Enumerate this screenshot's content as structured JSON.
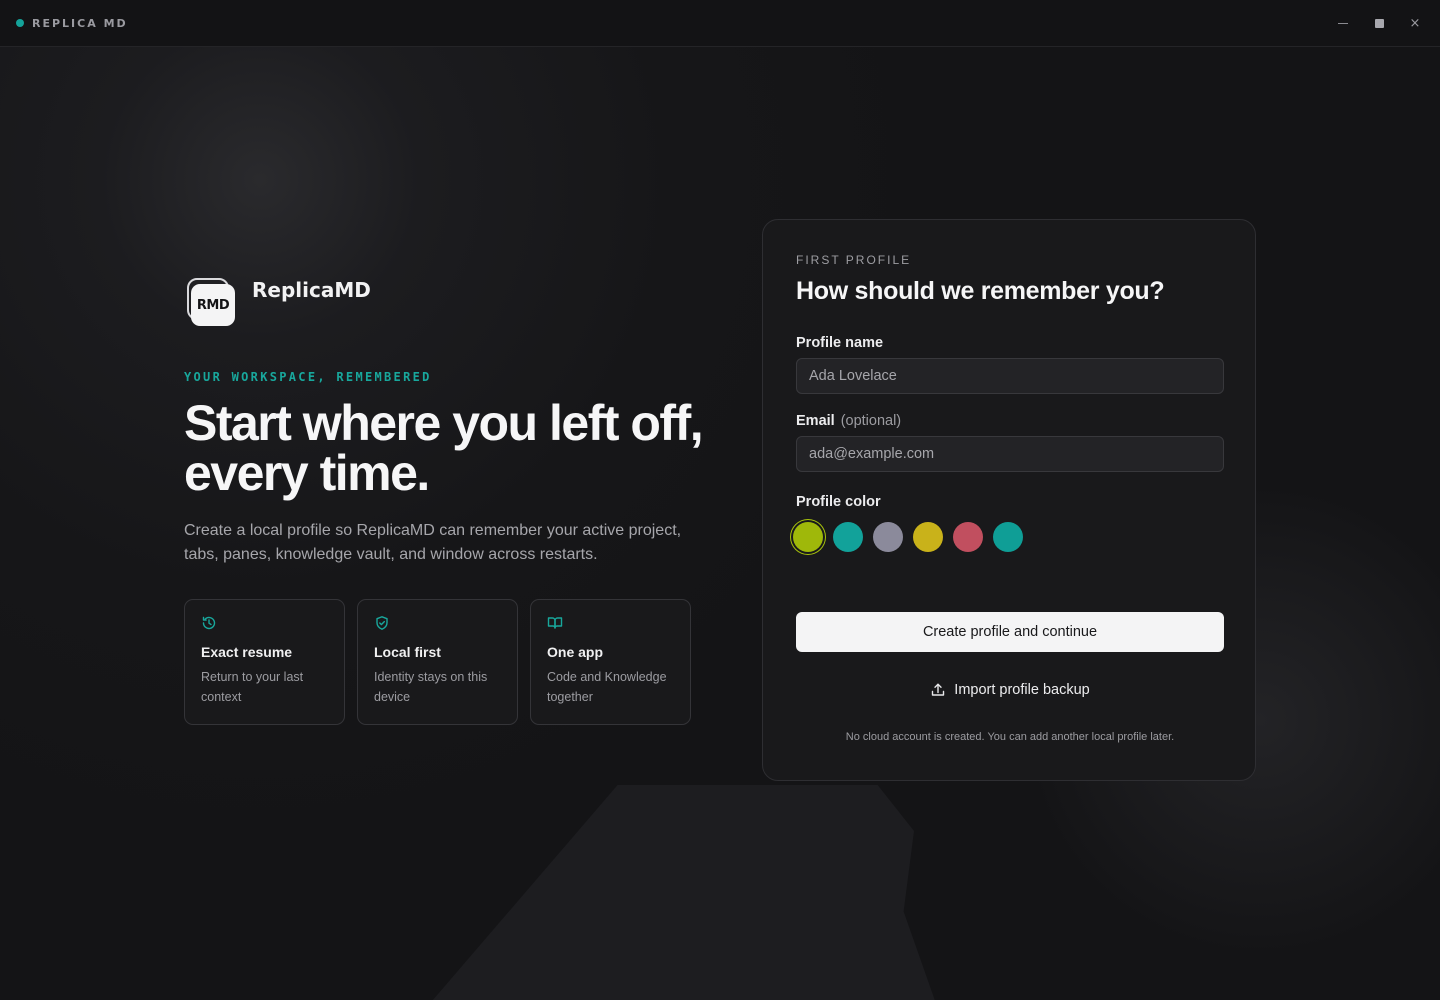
{
  "window": {
    "title": "REPLICA MD",
    "accent": "#14a39a",
    "controls": {
      "minimize": "minimize-icon",
      "maximize": "maximize-icon",
      "close": "×"
    }
  },
  "brand": {
    "logo_text": "RMD",
    "name": "ReplicaMD"
  },
  "hero": {
    "eyebrow": "YOUR WORKSPACE, REMEMBERED",
    "headline": "Start where you left off, every time.",
    "lead": "Create a local profile so ReplicaMD can remember your active project, tabs, panes, knowledge vault, and window across restarts."
  },
  "features": [
    {
      "icon": "history-icon",
      "title": "Exact resume",
      "desc": "Return to your last context"
    },
    {
      "icon": "shield-check-icon",
      "title": "Local first",
      "desc": "Identity stays on this device"
    },
    {
      "icon": "book-open-icon",
      "title": "One app",
      "desc": "Code and Knowledge together"
    }
  ],
  "form": {
    "eyebrow": "FIRST PROFILE",
    "title": "How should we remember you?",
    "name_label": "Profile name",
    "name_placeholder": "Ada Lovelace",
    "email_label": "Email",
    "email_optional": "(optional)",
    "email_placeholder": "ada@example.com",
    "color_label": "Profile color",
    "colors": [
      "#9fb80a",
      "#12a29a",
      "#8b8a9b",
      "#c9b21a",
      "#c14f5f",
      "#0f9e96"
    ],
    "selected_color_index": 0,
    "submit_label": "Create profile and continue",
    "import_label": "Import profile backup",
    "note": "No cloud account is created. You can add another local profile later."
  }
}
